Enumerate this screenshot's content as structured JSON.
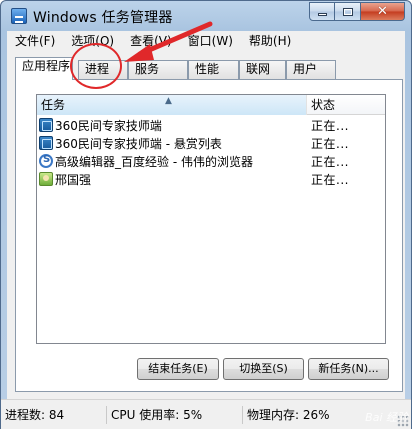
{
  "window": {
    "title": "Windows 任务管理器",
    "controls": {
      "minimize": "–",
      "maximize": "□",
      "close": "✕"
    }
  },
  "menubar": [
    "文件(F)",
    "选项(O)",
    "查看(V)",
    "窗口(W)",
    "帮助(H)"
  ],
  "tabs": [
    {
      "label": "应用程序",
      "active": true
    },
    {
      "label": "进程",
      "active": false
    },
    {
      "label": "服务",
      "active": false
    },
    {
      "label": "性能",
      "active": false
    },
    {
      "label": "联网",
      "active": false
    },
    {
      "label": "用户",
      "active": false
    }
  ],
  "list": {
    "columns": {
      "task": "任务",
      "status": "状态"
    },
    "rows": [
      {
        "icon": "360-app-icon",
        "task": "360民间专家技师端",
        "status": "正在..."
      },
      {
        "icon": "360-app-icon",
        "task": "360民间专家技师端 - 悬赏列表",
        "status": "正在..."
      },
      {
        "icon": "browser-icon",
        "task": "高级编辑器_百度经验 - 伟伟的浏览器",
        "status": "正在..."
      },
      {
        "icon": "user-folder-icon",
        "task": "邢国强",
        "status": "正在..."
      }
    ]
  },
  "buttons": {
    "end_task": "结束任务(E)",
    "switch_to": "切换至(S)",
    "new_task": "新任务(N)..."
  },
  "statusbar": {
    "processes": "进程数: 84",
    "cpu": "CPU 使用率: 5%",
    "memory": "物理内存: 26%"
  },
  "annotation": {
    "color": "#e0282a"
  },
  "watermark": "Bai 经验"
}
